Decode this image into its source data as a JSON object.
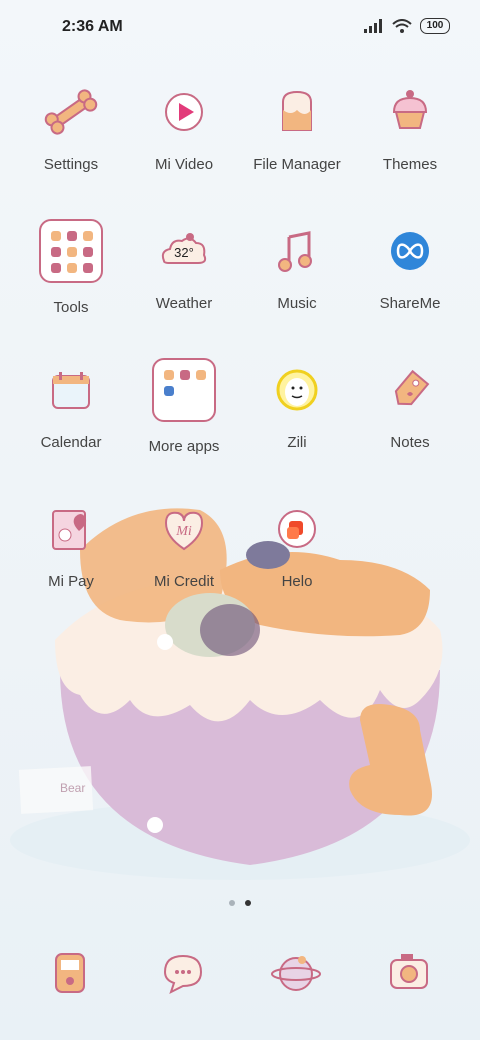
{
  "status_bar": {
    "time": "2:36 AM",
    "battery": "100"
  },
  "apps": [
    {
      "label": "Settings",
      "icon": "bone-icon"
    },
    {
      "label": "Mi Video",
      "icon": "play-icon"
    },
    {
      "label": "File Manager",
      "icon": "toast-icon"
    },
    {
      "label": "Themes",
      "icon": "cupcake-icon"
    },
    {
      "label": "Tools",
      "icon": "folder-icon"
    },
    {
      "label": "Weather",
      "icon": "cloud-icon",
      "badge": "32°"
    },
    {
      "label": "Music",
      "icon": "music-note-icon"
    },
    {
      "label": "ShareMe",
      "icon": "infinity-icon"
    },
    {
      "label": "Calendar",
      "icon": "calendar-icon"
    },
    {
      "label": "More apps",
      "icon": "folder-icon"
    },
    {
      "label": "Zili",
      "icon": "smiley-icon"
    },
    {
      "label": "Notes",
      "icon": "tag-icon"
    },
    {
      "label": "Mi Pay",
      "icon": "card-heart-icon"
    },
    {
      "label": "Mi Credit",
      "icon": "mi-credit-icon"
    },
    {
      "label": "Helo",
      "icon": "chat-icon"
    }
  ],
  "page_indicator": {
    "pages": 2,
    "active": 2
  },
  "dock": [
    {
      "name": "phone-icon"
    },
    {
      "name": "messages-icon"
    },
    {
      "name": "browser-icon"
    },
    {
      "name": "camera-icon"
    }
  ],
  "wallpaper": {
    "bear_tag": "Bear"
  },
  "colors": {
    "accent": "#c86a84",
    "cookie": "#f2b680",
    "cream": "#fbeee4",
    "cake": "#d9bbd8"
  }
}
